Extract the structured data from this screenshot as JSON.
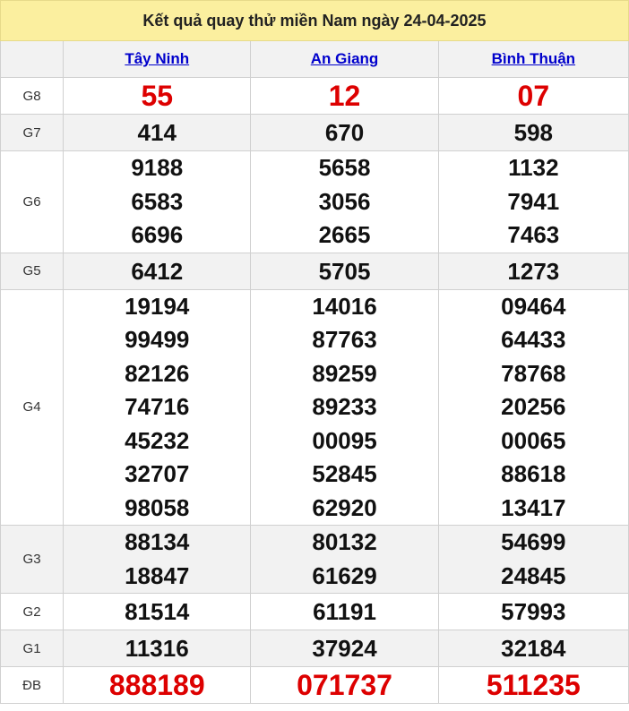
{
  "title": "Kết quả quay thử miền Nam ngày 24-04-2025",
  "provinces": [
    "Tây Ninh",
    "An Giang",
    "Bình Thuận"
  ],
  "prizes": [
    {
      "label": "G8",
      "values": [
        [
          "55"
        ],
        [
          "12"
        ],
        [
          "07"
        ]
      ]
    },
    {
      "label": "G7",
      "values": [
        [
          "414"
        ],
        [
          "670"
        ],
        [
          "598"
        ]
      ]
    },
    {
      "label": "G6",
      "values": [
        [
          "9188",
          "6583",
          "6696"
        ],
        [
          "5658",
          "3056",
          "2665"
        ],
        [
          "1132",
          "7941",
          "7463"
        ]
      ]
    },
    {
      "label": "G5",
      "values": [
        [
          "6412"
        ],
        [
          "5705"
        ],
        [
          "1273"
        ]
      ]
    },
    {
      "label": "G4",
      "values": [
        [
          "19194",
          "99499",
          "82126",
          "74716",
          "45232",
          "32707",
          "98058"
        ],
        [
          "14016",
          "87763",
          "89259",
          "89233",
          "00095",
          "52845",
          "62920"
        ],
        [
          "09464",
          "64433",
          "78768",
          "20256",
          "00065",
          "88618",
          "13417"
        ]
      ]
    },
    {
      "label": "G3",
      "values": [
        [
          "88134",
          "18847"
        ],
        [
          "80132",
          "61629"
        ],
        [
          "54699",
          "24845"
        ]
      ]
    },
    {
      "label": "G2",
      "values": [
        [
          "81514"
        ],
        [
          "61191"
        ],
        [
          "57993"
        ]
      ]
    },
    {
      "label": "G1",
      "values": [
        [
          "11316"
        ],
        [
          "37924"
        ],
        [
          "32184"
        ]
      ]
    },
    {
      "label": "ĐB",
      "values": [
        [
          "888189"
        ],
        [
          "071737"
        ],
        [
          "511235"
        ]
      ]
    }
  ],
  "colors": {
    "title_bg": "#fbef9f",
    "alt_row_bg": "#f2f2f2",
    "highlight_red": "#dd0000",
    "link_blue": "#0000cc"
  }
}
